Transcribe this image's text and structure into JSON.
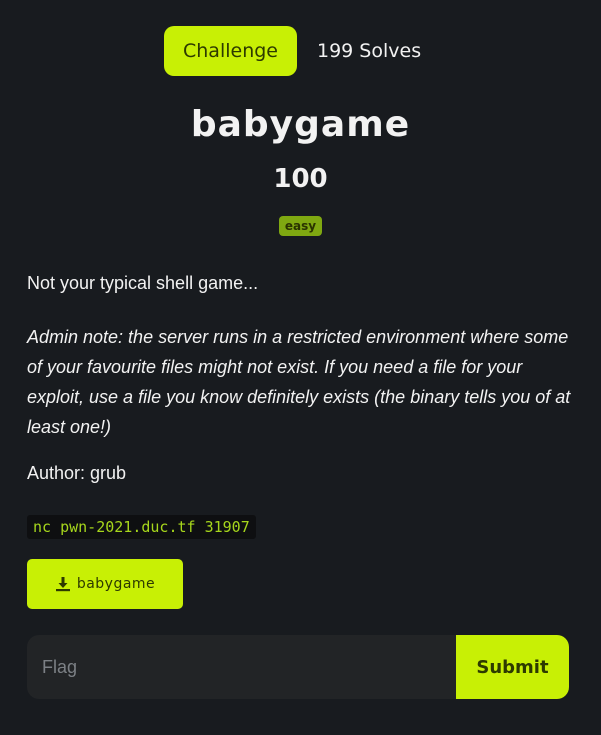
{
  "tabs": {
    "challenge_label": "Challenge",
    "solves_label": "199 Solves"
  },
  "challenge": {
    "name": "babygame",
    "points": "100",
    "difficulty": "easy",
    "description": "Not your typical shell game...",
    "admin_note": "Admin note: the server runs in a restricted environment where some of your favourite files might not exist. If you need a file for your exploit, use a file you know definitely exists (the binary tells you of at least one!)",
    "author": "Author: grub",
    "connection": "nc pwn-2021.duc.tf 31907",
    "file_name": "babygame",
    "file_icon": "download-icon"
  },
  "form": {
    "flag_placeholder": "Flag",
    "submit_label": "Submit"
  },
  "colors": {
    "background": "#181b1f",
    "accent": "#c8f005",
    "badge": "#7fa811",
    "code_text": "#a6d61c"
  }
}
